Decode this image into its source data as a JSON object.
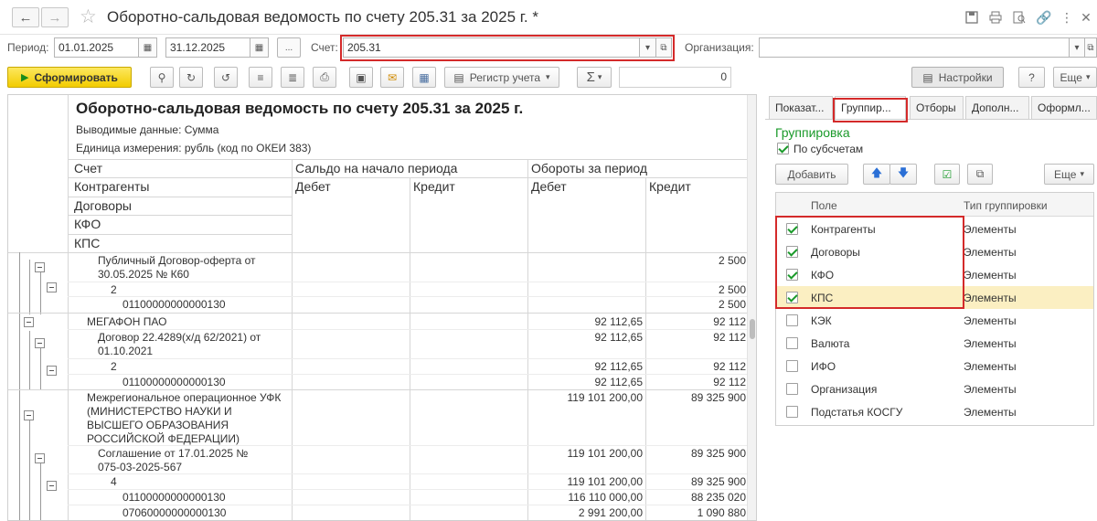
{
  "title": "Оборотно-сальдовая ведомость по счету 205.31 за 2025 г. *",
  "period": {
    "label": "Период:",
    "from": "01.01.2025",
    "to": "31.12.2025",
    "dots": "..."
  },
  "account": {
    "label": "Счет:",
    "value": "205.31"
  },
  "organization": {
    "label": "Организация:",
    "value": ""
  },
  "toolbar": {
    "generate": "Сформировать",
    "register": "Регистр учета",
    "sum_value": "0",
    "settings": "Настройки",
    "help": "?",
    "more": "Еще"
  },
  "report": {
    "title": "Оборотно-сальдовая ведомость по счету 205.31 за 2025 г.",
    "output": "Выводимые данные:   Сумма",
    "unit": "Единица измерения: рубль (код по ОКЕИ 383)",
    "headers": {
      "account": "Счет",
      "contractors": "Контрагенты",
      "contracts": "Договоры",
      "kfo": "КФО",
      "kps": "КПС",
      "opening": "Сальдо на начало периода",
      "turnover": "Обороты за период",
      "debit1": "Дебет",
      "credit1": "Кредит",
      "debit2": "Дебет",
      "credit2": "Кредит"
    },
    "rows": [
      {
        "name": "Публичный Договор-оферта от\n30.05.2025 № К60",
        "debit": "",
        "credit": "2 500"
      },
      {
        "name": "2",
        "debit": "",
        "credit": "2 500"
      },
      {
        "name": "01100000000000130",
        "debit": "",
        "credit": "2 500"
      },
      {
        "name": "МЕГАФОН ПАО",
        "debit": "92 112,65",
        "credit": "92 112"
      },
      {
        "name": "Договор 22.4289(х/д 62/2021) от\n01.10.2021",
        "debit": "92 112,65",
        "credit": "92 112"
      },
      {
        "name": "2",
        "debit": "92 112,65",
        "credit": "92 112"
      },
      {
        "name": "01100000000000130",
        "debit": "92 112,65",
        "credit": "92 112"
      },
      {
        "name": "Межрегиональное операционное УФК\n(МИНИСТЕРСТВО НАУКИ И\nВЫСШЕГО ОБРАЗОВАНИЯ\nРОССИЙСКОЙ ФЕДЕРАЦИИ)",
        "debit": "119 101 200,00",
        "credit": "89 325 900"
      },
      {
        "name": "Соглашение от 17.01.2025 №\n075-03-2025-567",
        "debit": "119 101 200,00",
        "credit": "89 325 900"
      },
      {
        "name": "4",
        "debit": "119 101 200,00",
        "credit": "89 325 900"
      },
      {
        "name": "01100000000000130",
        "debit": "116 110 000,00",
        "credit": "88 235 020"
      },
      {
        "name": "07060000000000130",
        "debit": "2 991 200,00",
        "credit": "1 090 880"
      }
    ]
  },
  "panel": {
    "tabs": [
      "Показат...",
      "Группир...",
      "Отборы",
      "Дополн...",
      "Оформл..."
    ],
    "section": "Группировка",
    "by_sub": "По субсчетам",
    "add": "Добавить",
    "more": "Еще",
    "col_field": "Поле",
    "col_type": "Тип группировки",
    "rows": [
      {
        "field": "Контрагенты",
        "type": "Элементы",
        "checked": true
      },
      {
        "field": "Договоры",
        "type": "Элементы",
        "checked": true
      },
      {
        "field": "КФО",
        "type": "Элементы",
        "checked": true
      },
      {
        "field": "КПС",
        "type": "Элементы",
        "checked": true
      },
      {
        "field": "КЭК",
        "type": "Элементы",
        "checked": false
      },
      {
        "field": "Валюта",
        "type": "Элементы",
        "checked": false
      },
      {
        "field": "ИФО",
        "type": "Элементы",
        "checked": false
      },
      {
        "field": "Организация",
        "type": "Элементы",
        "checked": false
      },
      {
        "field": "Подстатья КОСГУ",
        "type": "Элементы",
        "checked": false
      }
    ]
  }
}
